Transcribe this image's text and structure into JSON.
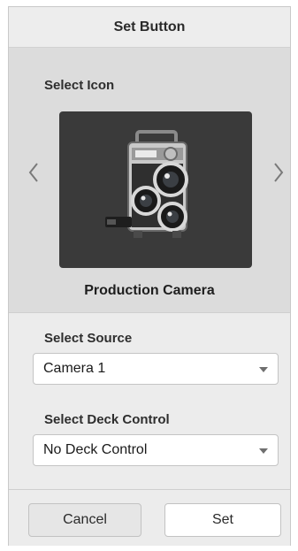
{
  "dialog": {
    "title": "Set Button"
  },
  "icon_picker": {
    "label": "Select Icon",
    "selected_icon": "camera-icon",
    "selected_name": "Production Camera",
    "prev_icon": "chevron-left-icon",
    "next_icon": "chevron-right-icon",
    "tile_color": "#3a3a3a"
  },
  "source": {
    "label": "Select Source",
    "value": "Camera 1"
  },
  "deck_control": {
    "label": "Select Deck Control",
    "value": "No Deck Control"
  },
  "actions": {
    "cancel_label": "Cancel",
    "set_label": "Set"
  }
}
